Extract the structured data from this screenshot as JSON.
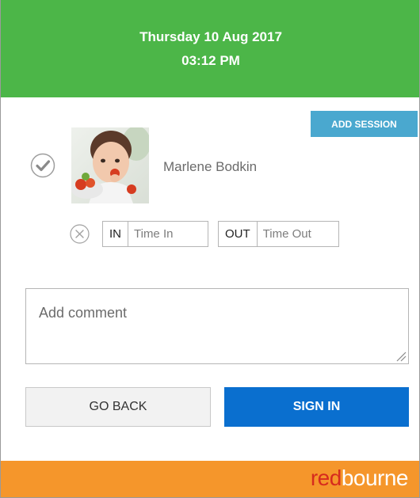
{
  "header": {
    "date": "Thursday 10 Aug 2017",
    "time": "03:12 PM"
  },
  "actions": {
    "add_session_label": "ADD SESSION"
  },
  "child": {
    "name": "Marlene Bodkin",
    "status_icon": "check-circle-icon"
  },
  "session": {
    "in_label": "IN",
    "in_placeholder": "Time In",
    "out_label": "OUT",
    "out_placeholder": "Time Out",
    "clear_icon": "x-circle-icon"
  },
  "comment": {
    "placeholder": "Add comment"
  },
  "buttons": {
    "go_back": "GO BACK",
    "sign_in": "SIGN IN"
  },
  "footer": {
    "logo_red": "red",
    "logo_white": "bourne"
  },
  "colors": {
    "header": "#4cb648",
    "add_session": "#4aa8cf",
    "sign_in": "#0a6fcf",
    "footer": "#f5962b",
    "logo_red": "#d62b1e"
  }
}
